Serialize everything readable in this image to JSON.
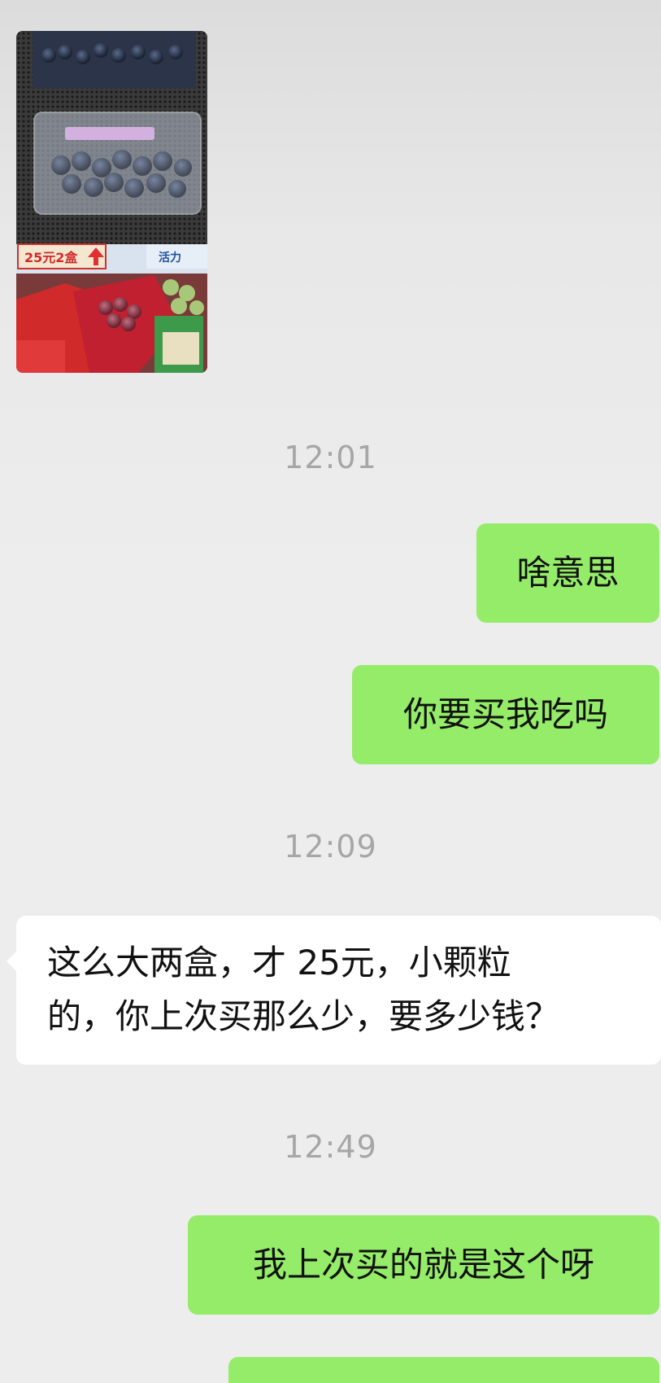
{
  "messages": [
    {
      "id": "img1",
      "type": "image",
      "side": "in",
      "image_labels": [
        "活力",
        "25元2盒"
      ]
    },
    {
      "type": "timestamp",
      "text": "12:01"
    },
    {
      "type": "text",
      "side": "out",
      "text": "啥意思"
    },
    {
      "type": "text",
      "side": "out",
      "text": "你要买我吃吗"
    },
    {
      "type": "timestamp",
      "text": "12:09"
    },
    {
      "type": "text",
      "side": "in",
      "lines": [
        "这么大两盒，才 25元，小颗粒",
        "的，你上次买那么少，要多少钱？"
      ]
    },
    {
      "type": "timestamp",
      "text": "12:49"
    },
    {
      "type": "text",
      "side": "out",
      "text": "我上次买的就是这个呀"
    }
  ],
  "colors": {
    "background": "#ededed",
    "outgoing_bubble": "#95ec69",
    "incoming_bubble": "#ffffff",
    "timestamp": "#a6a6a6"
  }
}
